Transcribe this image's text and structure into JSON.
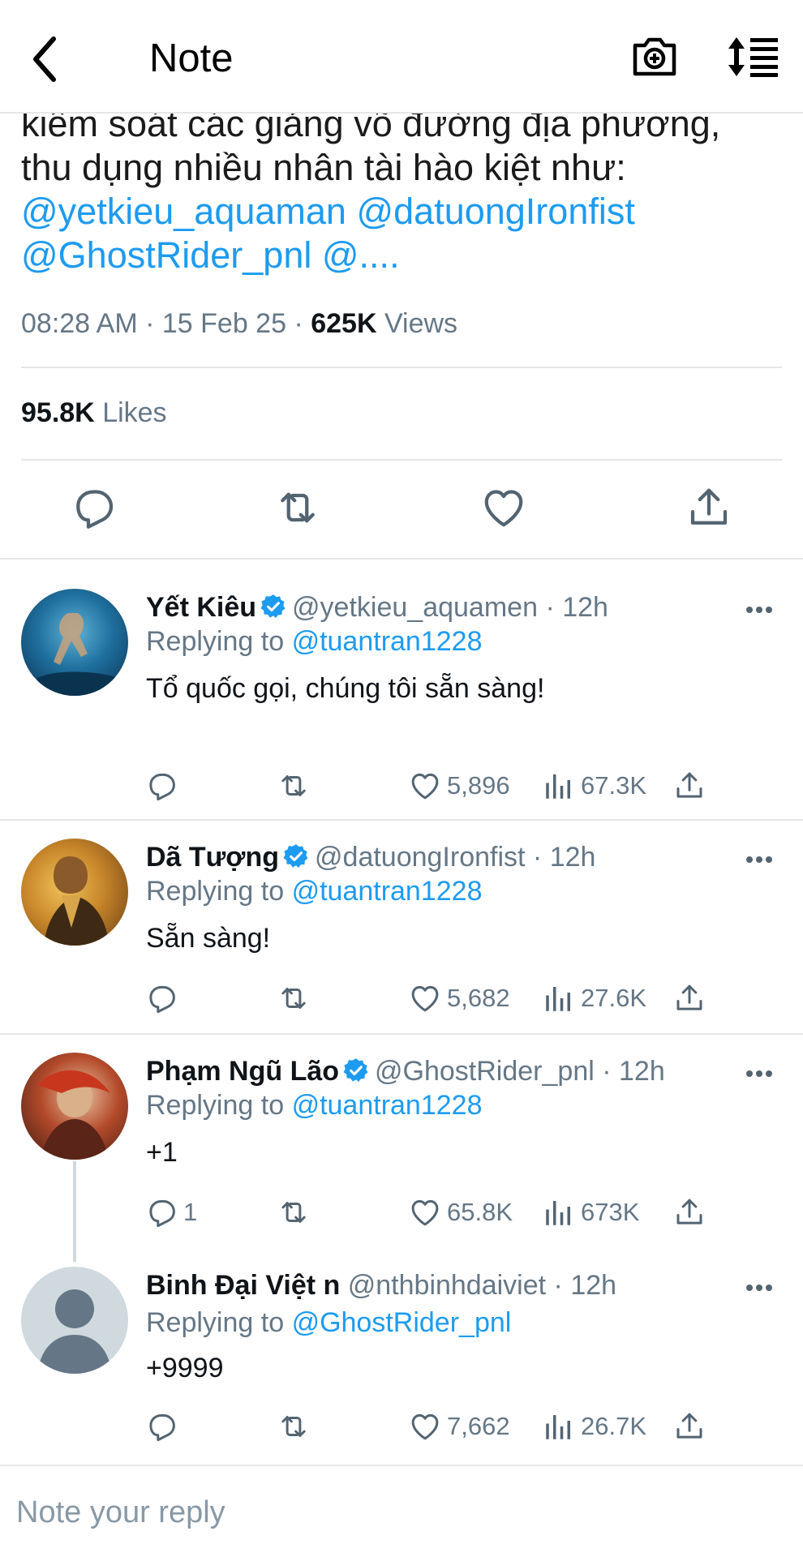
{
  "header": {
    "title": "Note",
    "icons": [
      "back-icon",
      "camera-add-icon",
      "sort-icon"
    ]
  },
  "tweet": {
    "text_line1": "kiêm soát các giảng võ đường địa phương,",
    "text_line2": "thu dụng nhiều nhân tài hào kiệt như:",
    "mention1": "@yetkieu_aquaman",
    "mention2": "@datuongIronfist",
    "mention3": "@GhostRider_pnl",
    "mention4": "@....",
    "time": "08:28 AM",
    "date": "15 Feb 25",
    "views_count": "625K",
    "views_label": "Views",
    "likes_count": "95.8K",
    "likes_label": "Likes"
  },
  "replies": [
    {
      "name": "Yết Kiêu",
      "handle": "@yetkieu_aquamen",
      "time": "· 12h",
      "replying_prefix": "Replying to",
      "replying_to": "@tuantran1228",
      "text": "Tổ quốc gọi, chúng tôi sẵn sàng!",
      "replies": "",
      "likes": "5,896",
      "views": "67.3K"
    },
    {
      "name": "Dã Tượng",
      "handle": "@datuongIronfist",
      "time": "· 12h",
      "replying_prefix": "Replying to",
      "replying_to": "@tuantran1228",
      "text": "Sẵn sàng!",
      "replies": "",
      "likes": "5,682",
      "views": "27.6K"
    },
    {
      "name": "Phạm Ngũ Lão",
      "handle": "@GhostRider_pnl",
      "time": "· 12h",
      "replying_prefix": "Replying to",
      "replying_to": "@tuantran1228",
      "text": "+1",
      "replies": "1",
      "likes": "65.8K",
      "views": "673K"
    },
    {
      "name": "Binh Đại Việt n",
      "handle": "@nthbinhdaiviet",
      "time": "· 12h",
      "replying_prefix": "Replying to",
      "replying_to": "@GhostRider_pnl",
      "text": "+9999",
      "replies": "",
      "likes": "7,662",
      "views": "26.7K"
    }
  ],
  "composer": {
    "placeholder": "Note your reply"
  },
  "colors": {
    "link": "#1d9bf0",
    "muted": "#657786",
    "divider": "#e6e6e6",
    "verified": "#1d9bf0"
  }
}
